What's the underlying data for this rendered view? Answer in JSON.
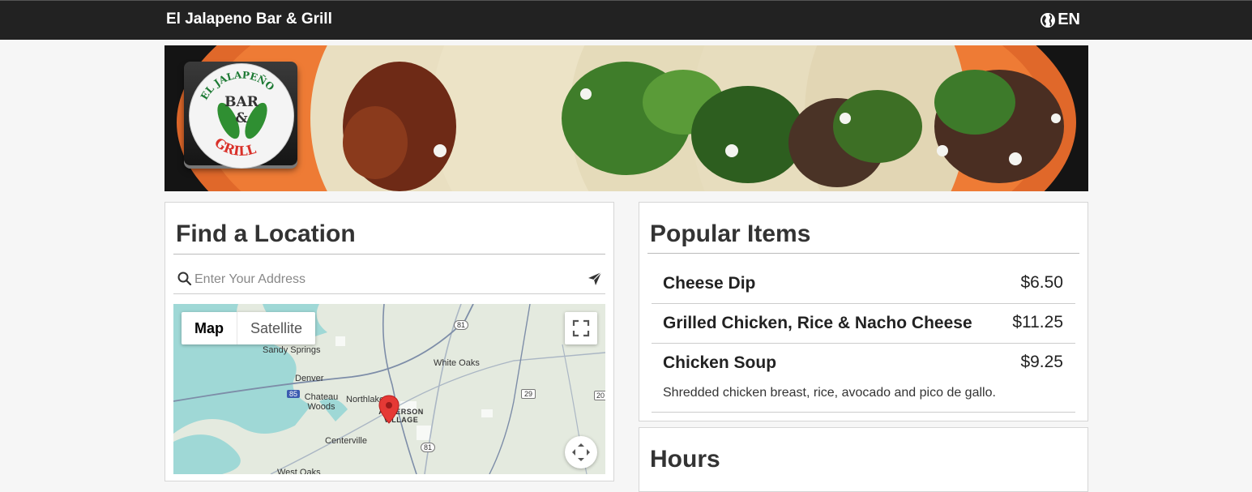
{
  "header": {
    "title": "El Jalapeno Bar & Grill",
    "language": "EN"
  },
  "logo": {
    "top_text": "EL JALAPEÑO",
    "middle_text": "BAR",
    "amp": "&",
    "bottom_text": "GRILL"
  },
  "location": {
    "heading": "Find a Location",
    "search_placeholder": "Enter Your Address",
    "map": {
      "type_options": [
        "Map",
        "Satellite"
      ],
      "selected": "Map",
      "places": [
        "Sandy Springs",
        "White Oaks",
        "Denver",
        "Chateau Woods",
        "Northlake",
        "Centerville",
        "ANDERSON VILLAGE",
        "West Oaks"
      ],
      "route_shields": [
        "81",
        "85",
        "29",
        "20",
        "81"
      ]
    }
  },
  "popular": {
    "heading": "Popular Items",
    "items": [
      {
        "name": "Cheese Dip",
        "price": "$6.50",
        "description": ""
      },
      {
        "name": "Grilled Chicken, Rice & Nacho Cheese",
        "price": "$11.25",
        "description": ""
      },
      {
        "name": "Chicken Soup",
        "price": "$9.25",
        "description": "Shredded chicken breast, rice, avocado and pico de gallo."
      }
    ]
  },
  "hours": {
    "heading": "Hours"
  }
}
